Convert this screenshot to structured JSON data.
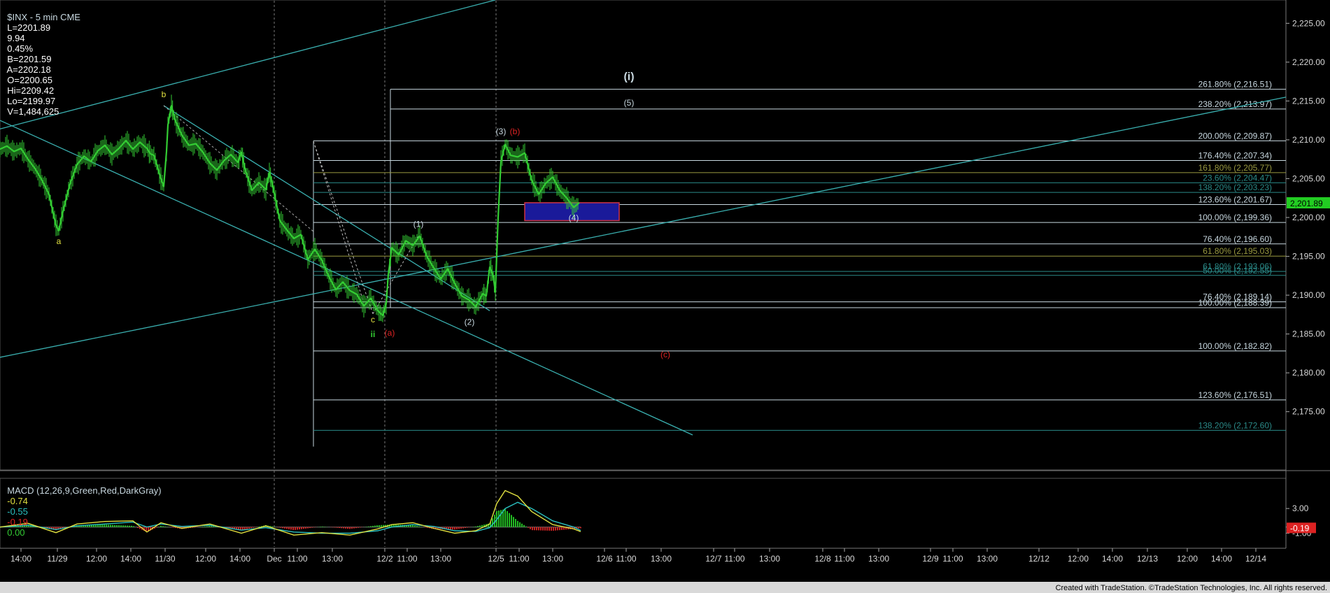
{
  "header": {
    "symbol": "$INX - 5 min CME",
    "last": "L=2201.89",
    "chg": "9.94",
    "pct": "0.45%",
    "bid": "B=2201.59",
    "ask": "A=2202.18",
    "open": "O=2200.65",
    "hi": "Hi=2209.42",
    "lo": "Lo=2199.97",
    "vol": "V=1,484,625"
  },
  "macd_header": {
    "label": "MACD (12,26,9,Green,Red,DarkGray)",
    "v1": "-0.74",
    "v2": "-0.55",
    "v3": "-0.19",
    "v4": "0.00"
  },
  "credit": "Created with TradeStation. ©TradeStation Technologies, Inc. All rights reserved.",
  "colors": {
    "bg": "#000000",
    "price": "#33cc33",
    "channel": "#3ab0b0",
    "fib_white": "#c8d8e0",
    "fib_teal": "#2a8a88",
    "fib_olive": "#9a9a40",
    "yellow": "#e0e040",
    "red": "#dd2222",
    "box": "#1a1a9a"
  },
  "chart_data": {
    "type": "line",
    "title": "$INX - 5 min CME",
    "ylim": [
      2167.5,
      2228
    ],
    "y_ticks": [
      "2,225.00",
      "2,220.00",
      "2,215.00",
      "2,210.00",
      "2,205.00",
      "2,200.00",
      "2,195.00",
      "2,190.00",
      "2,185.00",
      "2,180.00",
      "2,175.00"
    ],
    "y_tick_values": [
      2225,
      2220,
      2215,
      2210,
      2205,
      2200,
      2195,
      2190,
      2185,
      2180,
      2175
    ],
    "last_price": "2,201.89",
    "last_value": 2201.89,
    "x_ticks": [
      "14:00",
      "11/29",
      "12:00",
      "14:00",
      "11/30",
      "12:00",
      "14:00",
      "Dec",
      "11:00",
      "13:00",
      "12/2",
      "11:00",
      "13:00",
      "12/5",
      "11:00",
      "13:00",
      "12/6",
      "11:00",
      "13:00",
      "12/7",
      "11:00",
      "13:00",
      "12/8",
      "11:00",
      "13:00",
      "12/9",
      "11:00",
      "13:00",
      "12/12",
      "12:00",
      "14:00",
      "12/13",
      "12:00",
      "14:00",
      "12/14"
    ],
    "x_tick_pos": [
      30,
      82,
      138,
      187,
      236,
      294,
      343,
      392,
      425,
      475,
      550,
      582,
      630,
      709,
      742,
      790,
      864,
      895,
      945,
      1020,
      1050,
      1100,
      1176,
      1207,
      1256,
      1330,
      1362,
      1411,
      1485,
      1541,
      1590,
      1640,
      1697,
      1746,
      1795
    ],
    "series": [
      {
        "x": [
          0,
          10,
          20,
          30,
          40,
          50,
          60,
          70,
          80,
          84,
          90,
          100,
          110,
          120,
          130,
          140,
          150,
          160,
          170,
          180,
          190,
          200,
          210,
          215,
          220,
          230,
          234,
          238,
          240,
          245,
          250,
          260,
          270,
          280,
          290,
          300,
          310,
          320,
          330,
          340,
          345,
          350,
          360,
          370,
          380,
          385,
          390,
          400,
          410,
          420,
          430,
          440,
          450,
          460,
          470,
          480,
          490,
          500,
          510,
          520,
          530,
          540,
          547,
          552,
          555,
          560,
          570,
          580,
          590,
          600,
          610,
          620,
          630,
          640,
          650,
          660,
          670,
          680,
          690,
          695,
          700,
          705,
          708,
          712,
          716,
          722,
          730,
          740,
          750,
          760,
          770,
          780,
          790,
          800,
          810,
          820,
          828
        ],
        "y": [
          2208.8,
          2209.2,
          2208.5,
          2208.9,
          2207.5,
          2206.3,
          2204.8,
          2203.0,
          2199.0,
          2198.3,
          2200.8,
          2204.3,
          2206.8,
          2207.9,
          2207.2,
          2208.6,
          2209.3,
          2208.1,
          2208.9,
          2209.9,
          2208.8,
          2209.7,
          2208.9,
          2208.2,
          2208.0,
          2205.0,
          2204.0,
          2208.5,
          2211.9,
          2214.4,
          2212.6,
          2210.6,
          2209.3,
          2209.5,
          2208.4,
          2207.0,
          2206.1,
          2207.3,
          2208.1,
          2207.1,
          2208.4,
          2206.3,
          2203.5,
          2204.5,
          2203.6,
          2205.8,
          2204.0,
          2199.6,
          2198.4,
          2197.3,
          2197.8,
          2194.6,
          2195.9,
          2194.5,
          2192.4,
          2190.7,
          2191.7,
          2190.6,
          2190.1,
          2188.6,
          2189.6,
          2188.0,
          2187.4,
          2188.9,
          2192.6,
          2196.1,
          2195.2,
          2197.0,
          2196.4,
          2197.6,
          2195.0,
          2193.5,
          2192.1,
          2193.4,
          2191.5,
          2189.9,
          2189.4,
          2188.5,
          2190.2,
          2189.9,
          2193.6,
          2192.5,
          2190.4,
          2200.0,
          2207.2,
          2209.4,
          2208.0,
          2207.8,
          2208.3,
          2204.8,
          2203.0,
          2204.4,
          2205.2,
          2203.5,
          2202.5,
          2201.3,
          2201.9
        ]
      }
    ],
    "fib_levels": [
      {
        "label": "261.80% (2,216.51)",
        "value": 2216.51,
        "color": "#c8d8e0"
      },
      {
        "label": "238.20% (2,213.97)",
        "value": 2213.97,
        "color": "#c8d8e0"
      },
      {
        "label": "200.00% (2,209.87)",
        "value": 2209.87,
        "color": "#c8d8e0"
      },
      {
        "label": "176.40% (2,207.34)",
        "value": 2207.34,
        "color": "#c8d8e0"
      },
      {
        "label": "161.80% (2,205.77)",
        "value": 2205.77,
        "color": "#9a9a40"
      },
      {
        "label": "23.60% (2,204.47)",
        "value": 2204.47,
        "color": "#2a8a88"
      },
      {
        "label": "138.20% (2,203.23)",
        "value": 2203.23,
        "color": "#2a8a88"
      },
      {
        "label": "123.60% (2,201.67)",
        "value": 2201.67,
        "color": "#c8d8e0"
      },
      {
        "label": "100.00% (2,199.36)",
        "value": 2199.36,
        "color": "#c8d8e0"
      },
      {
        "label": "76.40% (2,196.60)",
        "value": 2196.6,
        "color": "#c8d8e0"
      },
      {
        "label": "61.80% (2,195.03)",
        "value": 2195.03,
        "color": "#9a9a40"
      },
      {
        "label": "61.80% (2,193.06)",
        "value": 2193.06,
        "color": "#2a8a88"
      },
      {
        "label": "50.00% (2,192.55)",
        "value": 2192.55,
        "color": "#2a8a88"
      },
      {
        "label": "76.40% (2,189.14)",
        "value": 2189.14,
        "color": "#c8d8e0"
      },
      {
        "label": "100.00% (2,188.39)",
        "value": 2188.39,
        "color": "#c8d8e0"
      },
      {
        "label": "100.00% (2,182.82)",
        "value": 2182.82,
        "color": "#c8d8e0"
      },
      {
        "label": "123.60% (2,176.51)",
        "value": 2176.51,
        "color": "#c8d8e0"
      },
      {
        "label": "138.20% (2,172.60)",
        "value": 2172.6,
        "color": "#2a8a88"
      }
    ],
    "wave_labels": [
      {
        "text": "a",
        "x": 84,
        "value": 2196.6,
        "color": "#e0e040"
      },
      {
        "text": "b",
        "x": 234,
        "value": 2215.5,
        "color": "#e0e040"
      },
      {
        "text": "c",
        "x": 533,
        "value": 2186.5,
        "color": "#e0e040"
      },
      {
        "text": "ii",
        "x": 533,
        "value": 2184.6,
        "color": "#33cc33"
      },
      {
        "text": "(a)",
        "x": 557,
        "value": 2184.8,
        "color": "#dd2222"
      },
      {
        "text": "(1)",
        "x": 598,
        "value": 2198.8,
        "color": "#c8d8e0"
      },
      {
        "text": "(2)",
        "x": 671,
        "value": 2186.2,
        "color": "#c8d8e0"
      },
      {
        "text": "(3)",
        "x": 716,
        "value": 2210.7,
        "color": "#c8d8e0"
      },
      {
        "text": "(b)",
        "x": 736,
        "value": 2210.7,
        "color": "#dd2222"
      },
      {
        "text": "(4)",
        "x": 820,
        "value": 2199.6,
        "color": "#c8d8e0"
      },
      {
        "text": "(5)",
        "x": 899,
        "value": 2214.4,
        "color": "#c8d8e0"
      },
      {
        "text": "(i)",
        "x": 899,
        "value": 2217.7,
        "color": "#c8d8e0"
      },
      {
        "text": "(c)",
        "x": 951,
        "value": 2182.0,
        "color": "#dd2222"
      }
    ],
    "macd": {
      "ylim": [
        -3.2,
        7.2
      ],
      "y_ticks": [
        "3.00",
        "0.00",
        "-1.00"
      ],
      "y_tick_values": [
        3,
        0,
        -1
      ],
      "last_value_label": "-0.19",
      "last_value": -0.19,
      "x": [
        0,
        40,
        80,
        110,
        150,
        190,
        210,
        230,
        260,
        300,
        345,
        380,
        420,
        460,
        500,
        540,
        560,
        590,
        620,
        650,
        680,
        700,
        710,
        722,
        740,
        760,
        790,
        820,
        830
      ],
      "macd_line": [
        0.0,
        0.6,
        -0.9,
        0.5,
        0.9,
        1.0,
        -0.8,
        0.7,
        -0.2,
        0.5,
        -1.0,
        0.2,
        -1.3,
        -0.9,
        -1.3,
        -0.3,
        0.4,
        0.7,
        -0.2,
        -1.0,
        -0.6,
        0.5,
        3.8,
        5.9,
        5.0,
        2.5,
        0.4,
        -0.3,
        -0.74
      ],
      "signal_line": [
        0.0,
        0.3,
        -0.4,
        0.2,
        0.5,
        0.8,
        0.0,
        0.5,
        0.1,
        0.3,
        -0.5,
        -0.1,
        -0.8,
        -1.0,
        -1.0,
        -0.6,
        0.0,
        0.4,
        0.1,
        -0.6,
        -0.7,
        -0.1,
        1.2,
        3.0,
        4.0,
        3.0,
        1.0,
        0.0,
        -0.55
      ]
    }
  }
}
